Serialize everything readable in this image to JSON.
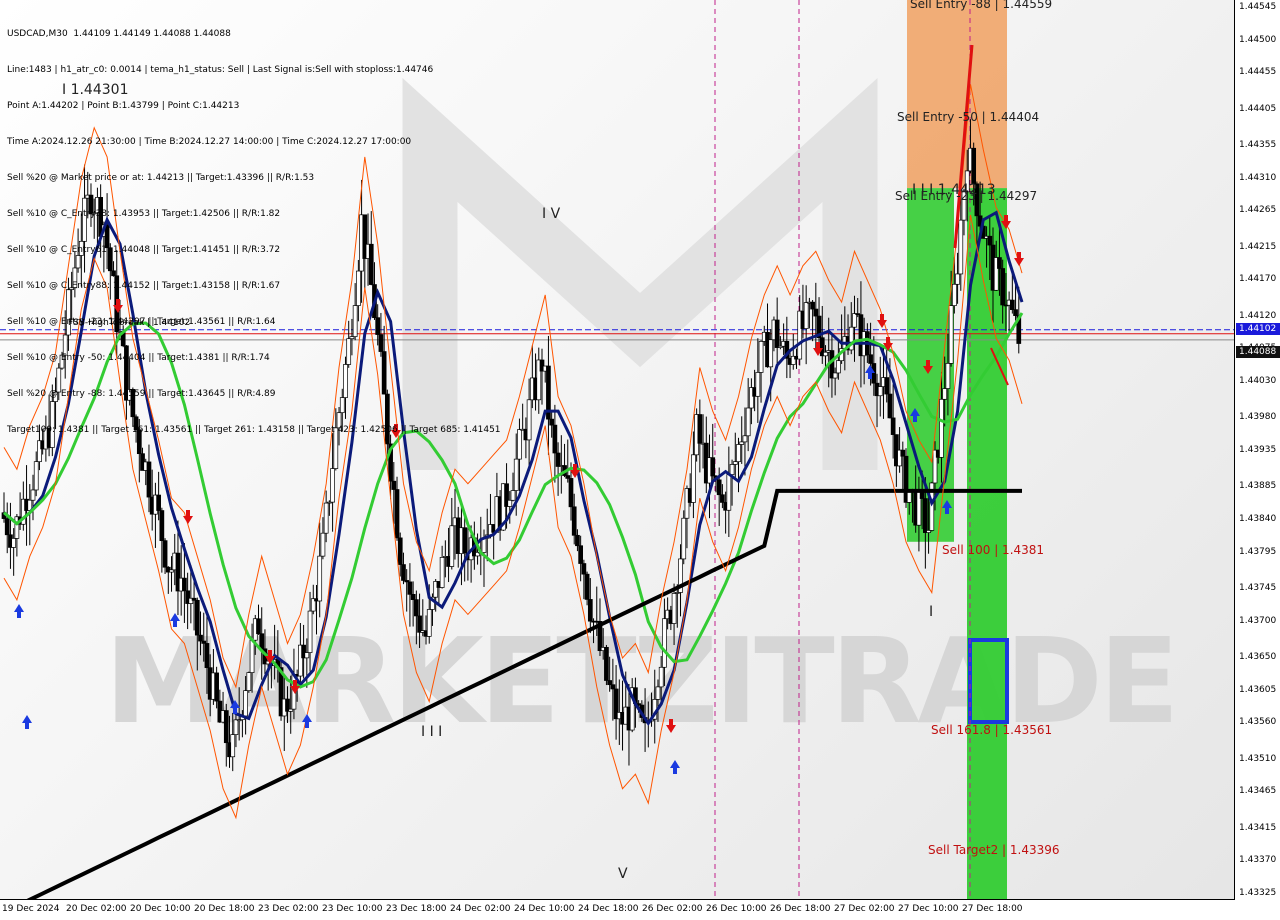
{
  "info_panel": {
    "lines": [
      "USDCAD,M30  1.44109 1.44149 1.44088 1.44088",
      "Line:1483 | h1_atr_c0: 0.0014 | tema_h1_status: Sell | Last Signal is:Sell with stoploss:1.44746",
      "Point A:1.44202 | Point B:1.43799 | Point C:1.44213",
      "Time A:2024.12.26 21:30:00 | Time B:2024.12.27 14:00:00 | Time C:2024.12.27 17:00:00",
      "Sell %20 @ Market price or at: 1.44213 || Target:1.43396 || R/R:1.53",
      "Sell %10 @ C_Entry38: 1.43953 || Target:1.42506 || R/R:1.82",
      "Sell %10 @ C_Entry61: 1.44048 || Target:1.41451 || R/R:3.72",
      "Sell %10 @ C_Entry88: 1.44152 || Target:1.43158 || R/R:1.67",
      "Sell %10 @ Entry -23: 1.44297 || Target:1.43561 || R/R:1.64",
      "Sell %10 @ Entry -50: 1.44404 || Target:1.4381 || R/R:1.74",
      "Sell %20 @ Entry -88: 1.44559 || Target:1.43645 || R/R:4.89",
      "Target100: 1.4381 || Target 161: 1.43561 || Target 261: 1.43158 || Target 423: 1.42506 || Target 685: 1.41451"
    ]
  },
  "price_axis": {
    "ticks": [
      "1.44545",
      "1.44500",
      "1.44455",
      "1.44405",
      "1.44355",
      "1.44310",
      "1.44265",
      "1.44215",
      "1.44170",
      "1.44120",
      "1.44075",
      "1.44030",
      "1.43980",
      "1.43935",
      "1.43885",
      "1.43840",
      "1.43795",
      "1.43745",
      "1.43700",
      "1.43650",
      "1.43605",
      "1.43560",
      "1.43510",
      "1.43465",
      "1.43415",
      "1.43370",
      "1.43325"
    ],
    "break_tag": "1.44102",
    "bid_tag": "1.44088"
  },
  "time_axis": {
    "ticks": [
      "19 Dec 2024",
      "20 Dec 02:00",
      "20 Dec 10:00",
      "20 Dec 18:00",
      "23 Dec 02:00",
      "23 Dec 10:00",
      "23 Dec 18:00",
      "24 Dec 02:00",
      "24 Dec 10:00",
      "24 Dec 18:00",
      "26 Dec 02:00",
      "26 Dec 10:00",
      "26 Dec 18:00",
      "27 Dec 02:00",
      "27 Dec 10:00",
      "27 Dec 18:00"
    ]
  },
  "annotations": {
    "fsb_break": "FSB-HighToBreak | 1.44102",
    "sell_entry_88": "Sell Entry -88 | 1.44559",
    "sell_entry_50": "Sell Entry -50 | 1.44404",
    "sell_entry_23": "Sell Entry -23 | 1.44297",
    "wave_label_c": "I I I 1.44213",
    "sell_100": "Sell 100 | 1.4381",
    "sell_161": "Sell 161.8 | 1.43561",
    "sell_target2": "Sell Target2 | 1.43396",
    "wave_i_price": "I 1.44301",
    "wave_iv": "I V",
    "wave_v": "V",
    "wave_iii": "I I I",
    "wave_i_bottom": "I"
  },
  "watermark": "MARKETZITRADE",
  "colors": {
    "zone_orange": "#f0a060",
    "zone_green": "#33cc33",
    "ma_fast": "#0b1a7a",
    "ma_mid": "#33cc33",
    "ma_slow": "#000000",
    "signal_red": "#e01010",
    "signal_blue": "#1a3ae0",
    "envelope": "#ff5500",
    "session_line": "#c0208a"
  },
  "chart_data": {
    "type": "candlestick",
    "symbol": "USDCAD",
    "timeframe": "M30",
    "ohlc_last": {
      "open": 1.44109,
      "high": 1.44149,
      "low": 1.44088,
      "close": 1.44088
    },
    "ylim": [
      1.43325,
      1.44545
    ],
    "x_categories": [
      "19 Dec 2024",
      "20 Dec 02:00",
      "20 Dec 10:00",
      "20 Dec 18:00",
      "23 Dec 02:00",
      "23 Dec 10:00",
      "23 Dec 18:00",
      "24 Dec 02:00",
      "24 Dec 10:00",
      "24 Dec 18:00",
      "26 Dec 02:00",
      "26 Dec 10:00",
      "26 Dec 18:00",
      "27 Dec 02:00",
      "27 Dec 10:00",
      "27 Dec 18:00"
    ],
    "close_path": [
      [
        0,
        1.4385
      ],
      [
        1,
        1.4382
      ],
      [
        2,
        1.4388
      ],
      [
        3,
        1.4392
      ],
      [
        4,
        1.4398
      ],
      [
        5,
        1.441
      ],
      [
        6,
        1.4422
      ],
      [
        7,
        1.4429
      ],
      [
        8,
        1.4425
      ],
      [
        9,
        1.4412
      ],
      [
        10,
        1.44
      ],
      [
        11,
        1.4393
      ],
      [
        12,
        1.4386
      ],
      [
        13,
        1.4378
      ],
      [
        14,
        1.4376
      ],
      [
        15,
        1.437
      ],
      [
        16,
        1.4364
      ],
      [
        17,
        1.4356
      ],
      [
        18,
        1.4352
      ],
      [
        19,
        1.4362
      ],
      [
        20,
        1.437
      ],
      [
        21,
        1.4364
      ],
      [
        22,
        1.4358
      ],
      [
        23,
        1.4362
      ],
      [
        24,
        1.437
      ],
      [
        25,
        1.438
      ],
      [
        26,
        1.4396
      ],
      [
        27,
        1.4408
      ],
      [
        28,
        1.4425
      ],
      [
        29,
        1.4413
      ],
      [
        30,
        1.4396
      ],
      [
        31,
        1.438
      ],
      [
        32,
        1.4372
      ],
      [
        33,
        1.4368
      ],
      [
        34,
        1.4376
      ],
      [
        35,
        1.4382
      ],
      [
        36,
        1.438
      ],
      [
        37,
        1.4382
      ],
      [
        38,
        1.4384
      ],
      [
        39,
        1.4386
      ],
      [
        40,
        1.4392
      ],
      [
        41,
        1.4399
      ],
      [
        42,
        1.4406
      ],
      [
        43,
        1.4392
      ],
      [
        44,
        1.4388
      ],
      [
        45,
        1.438
      ],
      [
        46,
        1.437
      ],
      [
        47,
        1.4362
      ],
      [
        48,
        1.4356
      ],
      [
        49,
        1.4358
      ],
      [
        50,
        1.4354
      ],
      [
        51,
        1.4364
      ],
      [
        52,
        1.4372
      ],
      [
        53,
        1.4382
      ],
      [
        54,
        1.4396
      ],
      [
        55,
        1.439
      ],
      [
        56,
        1.4386
      ],
      [
        57,
        1.4392
      ],
      [
        58,
        1.44
      ],
      [
        59,
        1.4406
      ],
      [
        60,
        1.441
      ],
      [
        61,
        1.4406
      ],
      [
        62,
        1.441
      ],
      [
        63,
        1.4412
      ],
      [
        64,
        1.4408
      ],
      [
        65,
        1.4405
      ],
      [
        66,
        1.4412
      ],
      [
        67,
        1.4408
      ],
      [
        68,
        1.4404
      ],
      [
        69,
        1.4398
      ],
      [
        70,
        1.439
      ],
      [
        71,
        1.4386
      ],
      [
        72,
        1.4383
      ],
      [
        73,
        1.4399
      ],
      [
        74,
        1.4415
      ],
      [
        75,
        1.4435
      ],
      [
        76,
        1.4426
      ],
      [
        77,
        1.4418
      ],
      [
        78,
        1.4415
      ],
      [
        79,
        1.4409
      ]
    ],
    "levels": [
      {
        "name": "FSB-HighToBreak",
        "value": 1.44102
      },
      {
        "name": "Sell Entry -88",
        "value": 1.44559
      },
      {
        "name": "Sell Entry -50",
        "value": 1.44404
      },
      {
        "name": "Sell Entry -23",
        "value": 1.44297
      },
      {
        "name": "Sell 100",
        "value": 1.4381
      },
      {
        "name": "Sell 161.8",
        "value": 1.43561
      },
      {
        "name": "Sell Target2",
        "value": 1.43396
      }
    ]
  }
}
